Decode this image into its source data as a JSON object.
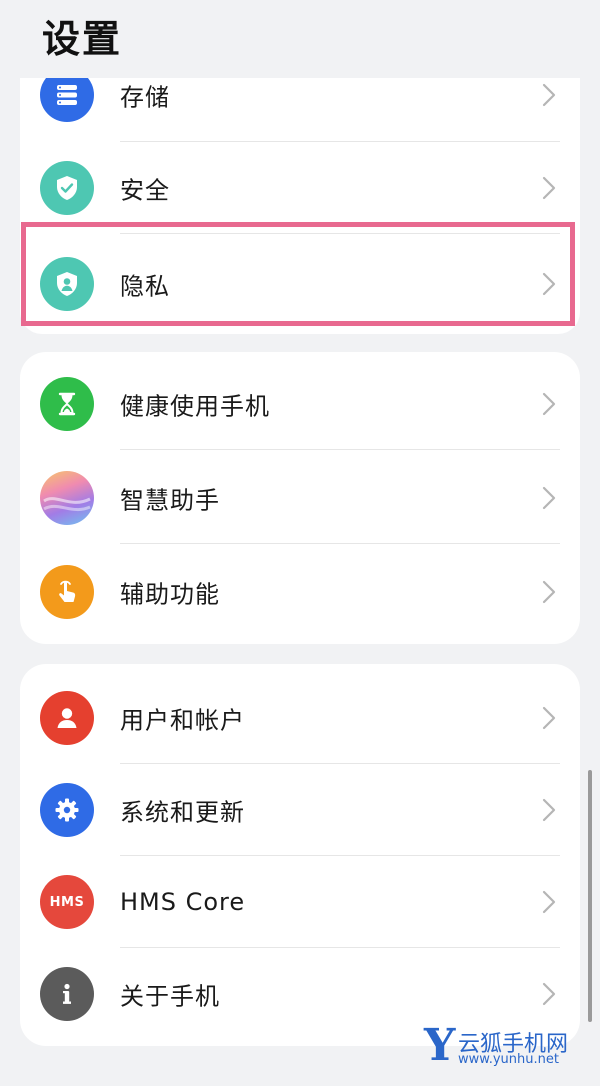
{
  "header": {
    "title": "设置"
  },
  "groups": [
    {
      "items": [
        {
          "label": "存储",
          "icon": "storage-icon",
          "color": "#2f6be6"
        },
        {
          "label": "安全",
          "icon": "shield-check-icon",
          "color": "#4ec7b2"
        },
        {
          "label": "隐私",
          "icon": "privacy-shield-icon",
          "color": "#4ec7b2"
        }
      ]
    },
    {
      "items": [
        {
          "label": "健康使用手机",
          "icon": "hourglass-icon",
          "color": "#2fbd4a"
        },
        {
          "label": "智慧助手",
          "icon": "smart-assistant-icon",
          "color": "#b98ae8"
        },
        {
          "label": "辅助功能",
          "icon": "hand-touch-icon",
          "color": "#f39a1b"
        }
      ]
    },
    {
      "items": [
        {
          "label": "用户和帐户",
          "icon": "user-icon",
          "color": "#e5402f"
        },
        {
          "label": "系统和更新",
          "icon": "settings-gear-icon",
          "color": "#2f6be6"
        },
        {
          "label": "HMS Core",
          "icon": "hms-icon",
          "color": "#e5483c",
          "icon_text": "HMS"
        },
        {
          "label": "关于手机",
          "icon": "info-icon",
          "color": "#5b5b5b"
        }
      ]
    }
  ],
  "highlight_color": "#e8698f",
  "watermark": {
    "letter": "Y",
    "name": "云狐手机网",
    "url": "www.yunhu.net"
  }
}
